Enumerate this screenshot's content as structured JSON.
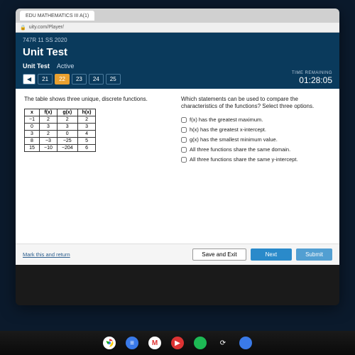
{
  "browser": {
    "tab_title": "EDU MATHEMATICS III A(1)",
    "url_prefix": "uity.com/Player/",
    "lock_glyph": "🔒"
  },
  "header": {
    "session": "747R 11 SS 2020",
    "title": "Unit Test",
    "sub_label": "Unit Test",
    "sub_status": "Active"
  },
  "nav": {
    "prev_glyph": "◀",
    "pages": [
      "21",
      "22",
      "23",
      "24",
      "25"
    ],
    "current_index": 1
  },
  "timer": {
    "label": "TIME REMAINING",
    "value": "01:28:05"
  },
  "question": {
    "left_prompt": "The table shows three unique, discrete functions.",
    "right_prompt": "Which statements can be used to compare the characteristics of the functions? Select three options.",
    "table": {
      "headers": [
        "x",
        "f(x)",
        "g(x)",
        "h(x)"
      ],
      "rows": [
        [
          "−1",
          "2",
          "2",
          "2"
        ],
        [
          "0",
          "3",
          "3",
          "3"
        ],
        [
          "3",
          "2",
          "0",
          "4"
        ],
        [
          "8",
          "−3",
          "−25",
          "5"
        ],
        [
          "15",
          "−10",
          "−204",
          "6"
        ]
      ]
    },
    "options": [
      "f(x) has the greatest maximum.",
      "h(x) has the greatest x-intercept.",
      "g(x) has the smallest minimum value.",
      "All three functions share the same domain.",
      "All three functions share the same y-intercept."
    ]
  },
  "footer": {
    "mark": "Mark this and return",
    "save": "Save and Exit",
    "next": "Next",
    "submit": "Submit"
  },
  "chart_data": {
    "type": "table",
    "title": "Three discrete functions",
    "columns": [
      "x",
      "f(x)",
      "g(x)",
      "h(x)"
    ],
    "rows": [
      [
        -1,
        2,
        2,
        2
      ],
      [
        0,
        3,
        3,
        3
      ],
      [
        3,
        2,
        0,
        4
      ],
      [
        8,
        -3,
        -25,
        5
      ],
      [
        15,
        -10,
        -204,
        6
      ]
    ]
  }
}
